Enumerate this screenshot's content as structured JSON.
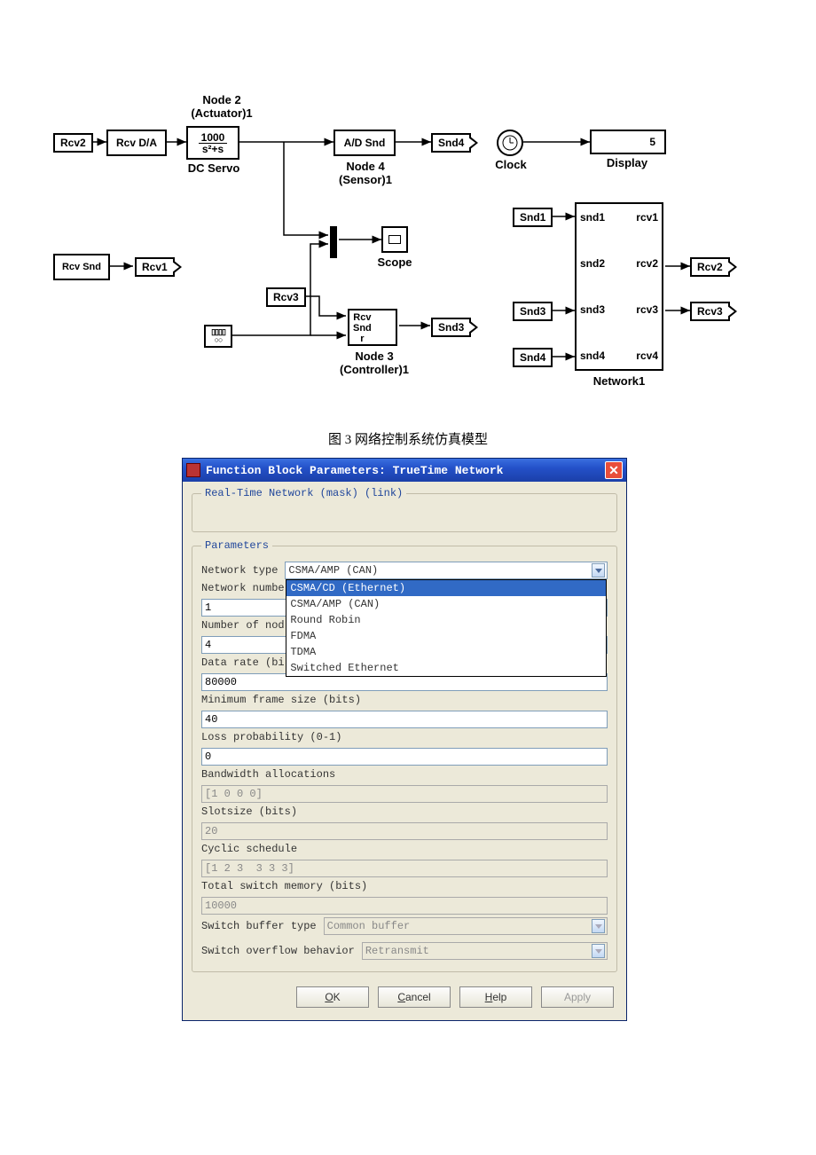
{
  "caption": "图 3  网络控制系统仿真模型",
  "diagram": {
    "node2_label": "Node 2\n(Actuator)1",
    "node3_label": "Node 3\n(Controller)1",
    "node4_label": "Node 4\n(Sensor)1",
    "dcservo_label": "DC Servo",
    "dcservo_num": "1000",
    "dcservo_den": "s²+s",
    "scope_label": "Scope",
    "clock_label": "Clock",
    "display_label": "Display",
    "display_value": "5",
    "network_label": "Network1",
    "rcv2_tag": "Rcv2",
    "rcv_da": "Rcv D/A",
    "ad_snd": "A/D  Snd",
    "snd4_tag": "Snd4",
    "rcvsnd_blk": "Rcv Snd",
    "rcv1_tag": "Rcv1",
    "rcv3_tag": "Rcv3",
    "node3_ports": "Rcv\nSnd\nr",
    "snd3_tag": "Snd3",
    "net_snd1": "snd1",
    "net_rcv1": "rcv1",
    "net_snd2": "snd2",
    "net_rcv2": "rcv2",
    "net_snd3": "snd3",
    "net_rcv3": "rcv3",
    "net_snd4": "snd4",
    "net_rcv4": "rcv4",
    "snd1_tag": "Snd1",
    "snd2_tag": "",
    "snd3b_tag": "Snd3",
    "snd4b_tag": "Snd4",
    "rcv2b_tag": "Rcv2",
    "rcv3b_tag": "Rcv3"
  },
  "dialog": {
    "title": "Function Block Parameters: TrueTime Network",
    "mask_legend": "Real-Time Network (mask) (link)",
    "params_legend": "Parameters",
    "network_type_label": "Network type",
    "network_type_value": "CSMA/AMP (CAN)",
    "network_type_options": [
      "CSMA/CD (Ethernet)",
      "CSMA/AMP (CAN)",
      "Round Robin",
      "FDMA",
      "TDMA",
      "Switched Ethernet"
    ],
    "network_number_label": "Network numbe",
    "network_number_value": "1",
    "num_nodes_label": "Number of nod",
    "num_nodes_value": "4",
    "data_rate_label": "Data rate (bi",
    "data_rate_value": "80000",
    "min_frame_label": "Minimum frame size (bits)",
    "min_frame_value": "40",
    "loss_prob_label": "Loss probability (0-1)",
    "loss_prob_value": "0",
    "bandwidth_label": "Bandwidth allocations",
    "bandwidth_value": "[1 0 0 0]",
    "slotsize_label": "Slotsize (bits)",
    "slotsize_value": "20",
    "cyclic_label": "Cyclic schedule",
    "cyclic_value": "[1 2 3  3 3 3]",
    "switch_mem_label": "Total switch memory (bits)",
    "switch_mem_value": "10000",
    "switch_buf_label": "Switch buffer type",
    "switch_buf_value": "Common buffer",
    "switch_ovf_label": "Switch overflow behavior",
    "switch_ovf_value": "Retransmit",
    "ok": "OK",
    "cancel": "Cancel",
    "help": "Help",
    "apply": "Apply"
  }
}
